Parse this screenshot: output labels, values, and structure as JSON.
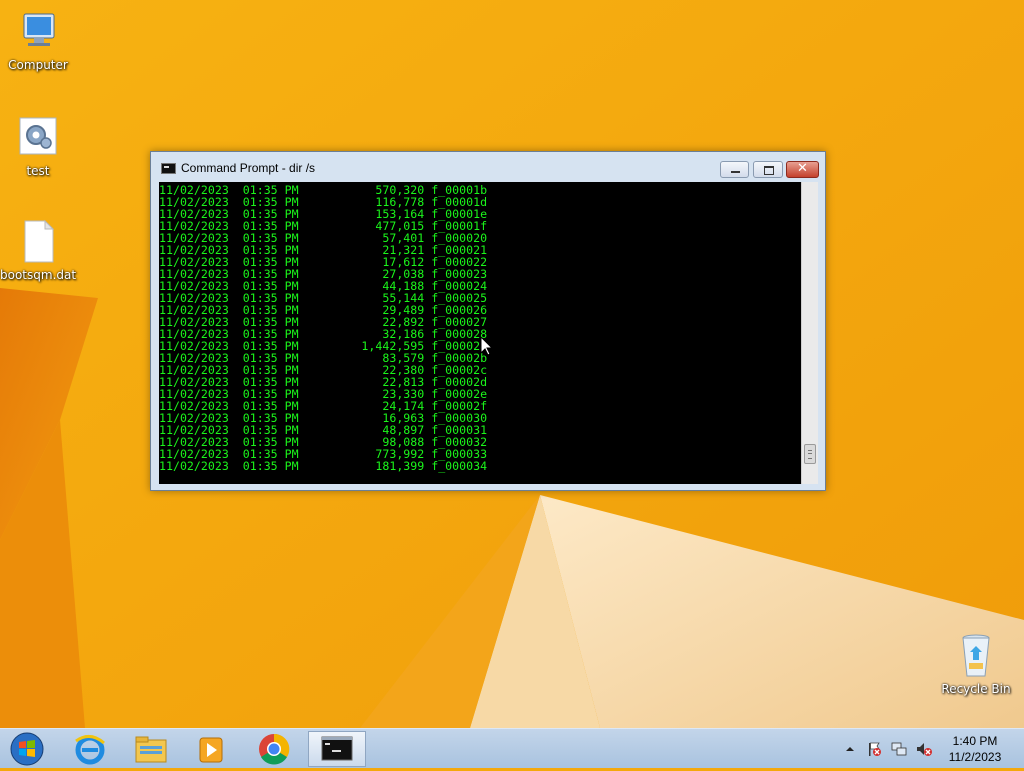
{
  "desktop": {
    "icons": [
      {
        "label": "Computer",
        "icon": "computer-icon"
      },
      {
        "label": "test",
        "icon": "settings-file-icon"
      },
      {
        "label": "bootsqm.dat",
        "icon": "file-icon"
      },
      {
        "label": "Recycle Bin",
        "icon": "recycle-bin-icon"
      }
    ]
  },
  "window": {
    "title": "Command Prompt - dir  /s",
    "console_color": "#1bf51b",
    "lines": [
      "11/02/2023  01:35 PM           570,320 f_00001b",
      "11/02/2023  01:35 PM           116,778 f_00001d",
      "11/02/2023  01:35 PM           153,164 f_00001e",
      "11/02/2023  01:35 PM           477,015 f_00001f",
      "11/02/2023  01:35 PM            57,401 f_000020",
      "11/02/2023  01:35 PM            21,321 f_000021",
      "11/02/2023  01:35 PM            17,612 f_000022",
      "11/02/2023  01:35 PM            27,038 f_000023",
      "11/02/2023  01:35 PM            44,188 f_000024",
      "11/02/2023  01:35 PM            55,144 f_000025",
      "11/02/2023  01:35 PM            29,489 f_000026",
      "11/02/2023  01:35 PM            22,892 f_000027",
      "11/02/2023  01:35 PM            32,186 f_000028",
      "11/02/2023  01:35 PM         1,442,595 f_00002a",
      "11/02/2023  01:35 PM            83,579 f_00002b",
      "11/02/2023  01:35 PM            22,380 f_00002c",
      "11/02/2023  01:35 PM            22,813 f_00002d",
      "11/02/2023  01:35 PM            23,330 f_00002e",
      "11/02/2023  01:35 PM            24,174 f_00002f",
      "11/02/2023  01:35 PM            16,963 f_000030",
      "11/02/2023  01:35 PM            48,897 f_000031",
      "11/02/2023  01:35 PM            98,088 f_000032",
      "11/02/2023  01:35 PM           773,992 f_000033",
      "11/02/2023  01:35 PM           181,399 f_000034"
    ],
    "buttons": {
      "minimize": "minimize-icon",
      "maximize": "maximize-icon",
      "close_glyph": "✕"
    }
  },
  "taskbar": {
    "items": [
      "windows-start-icon",
      "internet-explorer-icon",
      "file-explorer-icon",
      "media-player-icon",
      "chrome-icon",
      "command-prompt-icon"
    ],
    "tray": {
      "icons": [
        "show-hidden-icons-chevron",
        "action-center-flag-icon",
        "network-icon",
        "volume-muted-icon"
      ],
      "time": "1:40 PM",
      "date": "11/2/2023"
    }
  }
}
